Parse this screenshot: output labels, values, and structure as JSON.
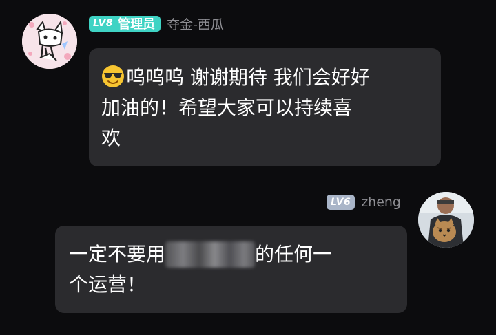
{
  "messages": {
    "incoming": {
      "badge_level": "LV8",
      "badge_role": "管理员",
      "username": "夺金-西瓜",
      "emoji": "smiling-face-with-sunglasses-icon",
      "text_line1": "呜呜呜 谢谢期待 我们会好好",
      "text_line2": "加油的！希望大家可以持续喜",
      "text_line3": "欢"
    },
    "outgoing": {
      "badge_level": "LV6",
      "username": "zheng",
      "text_before_redaction": "一定不要用",
      "text_after_redaction": "的任何一",
      "text_line2": "个运营！"
    }
  },
  "colors": {
    "background": "#0c0c0e",
    "bubble": "#2b2b2e",
    "admin_badge": "#3fd3c4",
    "lv6_badge": "#a9b5c8",
    "username": "#8e8e93",
    "message_text": "#ffffff"
  }
}
